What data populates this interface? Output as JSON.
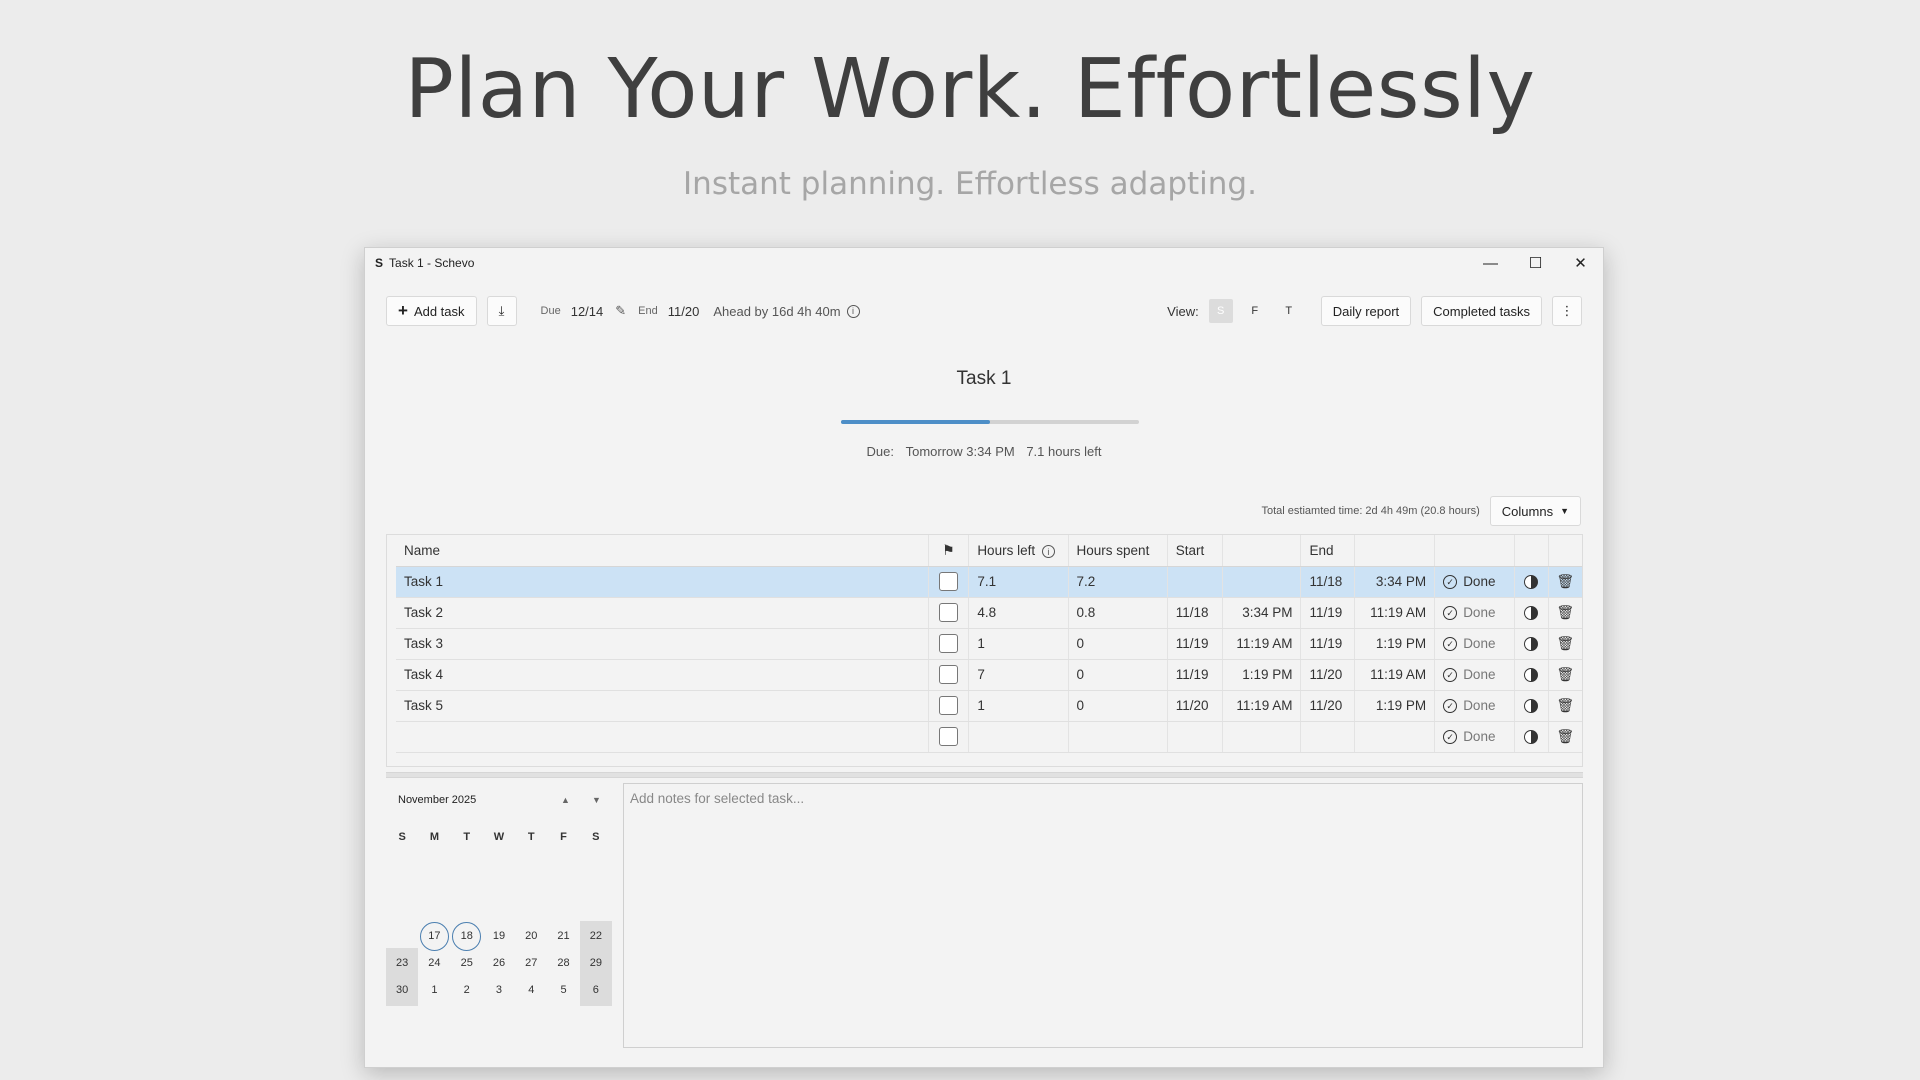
{
  "hero": {
    "title": "Plan Your Work. Effortlessly",
    "subtitle": "Instant planning. Effortless adapting."
  },
  "window": {
    "title": "Task 1 - Schevo",
    "logo": "S",
    "controls": {
      "minimize": "—",
      "maximize": "☐",
      "close": "✕"
    }
  },
  "toolbar": {
    "add_task": "Add task",
    "download_icon": "⤓",
    "due_label": "Due",
    "due_value": "12/14",
    "end_label": "End",
    "end_value": "11/20",
    "ahead": "Ahead by 16d 4h 40m",
    "view_label": "View:",
    "view_options": [
      "S",
      "F",
      "T"
    ],
    "daily_report": "Daily report",
    "completed_tasks": "Completed tasks",
    "more": "⋮"
  },
  "task_panel": {
    "title": "Task 1",
    "progress": 0.5,
    "due_label": "Due:",
    "due_value": "Tomorrow 3:34 PM",
    "hours_left": "7.1 hours left",
    "progress_color": "#4d8ec7"
  },
  "total": {
    "text": "Total estiamted time: 2d 4h 49m  (20.8 hours)",
    "columns_button": "Columns"
  },
  "table": {
    "headers": {
      "name": "Name",
      "flag": "⚑",
      "hours_left": "Hours left",
      "hours_spent": "Hours spent",
      "start": "Start",
      "end": "End"
    },
    "rows": [
      {
        "name": "Task 1",
        "hours_left": "7.1",
        "hours_spent": "7.2",
        "start_date": "",
        "start_time": "",
        "end_date": "11/18",
        "end_time": "3:34 PM",
        "done": "Done"
      },
      {
        "name": "Task 2",
        "hours_left": "4.8",
        "hours_spent": "0.8",
        "start_date": "11/18",
        "start_time": "3:34 PM",
        "end_date": "11/19",
        "end_time": "11:19 AM",
        "done": "Done"
      },
      {
        "name": "Task 3",
        "hours_left": "1",
        "hours_spent": "0",
        "start_date": "11/19",
        "start_time": "11:19 AM",
        "end_date": "11/19",
        "end_time": "1:19 PM",
        "done": "Done"
      },
      {
        "name": "Task 4",
        "hours_left": "7",
        "hours_spent": "0",
        "start_date": "11/19",
        "start_time": "1:19 PM",
        "end_date": "11/20",
        "end_time": "11:19 AM",
        "done": "Done"
      },
      {
        "name": "Task 5",
        "hours_left": "1",
        "hours_spent": "0",
        "start_date": "11/20",
        "start_time": "11:19 AM",
        "end_date": "11/20",
        "end_time": "1:19 PM",
        "done": "Done"
      },
      {
        "name": "",
        "hours_left": "",
        "hours_spent": "",
        "start_date": "",
        "start_time": "",
        "end_date": "",
        "end_time": "",
        "done": "Done"
      }
    ],
    "selected_color": "#cce2f5"
  },
  "calendar": {
    "month": "November 2025",
    "up": "▲",
    "down": "▼",
    "weekdays": [
      "S",
      "M",
      "T",
      "W",
      "T",
      "F",
      "S"
    ],
    "rows": [
      [
        "",
        "17",
        "18",
        "19",
        "20",
        "21",
        "22"
      ],
      [
        "23",
        "24",
        "25",
        "26",
        "27",
        "28",
        "29"
      ],
      [
        "30",
        "1",
        "2",
        "3",
        "4",
        "5",
        "6"
      ]
    ]
  },
  "notes": {
    "placeholder": "Add notes for selected task..."
  }
}
